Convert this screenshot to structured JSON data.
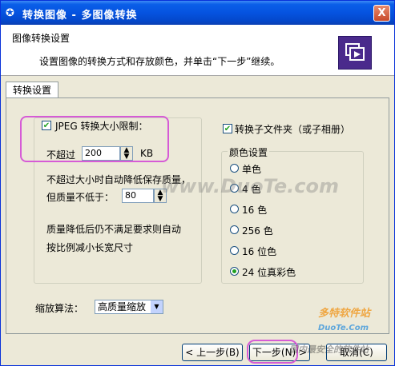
{
  "window": {
    "title": "转换图像 - 多图像转换",
    "close_glyph": "X"
  },
  "header": {
    "title": "图像转换设置",
    "description": "设置图像的转换方式和存放颜色，并单击“下一步”继续。"
  },
  "tab": {
    "label": "转换设置"
  },
  "jpeg": {
    "checkbox_label": "JPEG 转换大小限制：",
    "checked": true,
    "limit_label": "不超过",
    "limit_value": "200",
    "unit": "KB",
    "auto_text_1": "不超过大小时自动降低保存质量，",
    "quality_label": "但质量不低于：",
    "quality_value": "80",
    "note_1": "质量降低后仍不满足要求则自动",
    "note_2": "按比例减小长宽尺寸"
  },
  "subfolder": {
    "checkbox_label": "转换子文件夹（或子相册）",
    "checked": true
  },
  "color": {
    "group_label": "颜色设置",
    "options": [
      "单色",
      "4 色",
      "16 色",
      "256 色",
      "16 位色",
      "24 位真彩色"
    ],
    "selected_index": 5
  },
  "scale": {
    "label": "缩放算法：",
    "value": "高质量缩放"
  },
  "buttons": {
    "back": "< 上一步(B)",
    "next": "下一步(N) >",
    "cancel": "取消(C)"
  },
  "watermarks": {
    "center": "www.DuoTe.com",
    "logo": "多特软件站",
    "logo_url": "DuoTe.Com",
    "bottom": "国内最安全的软件站"
  },
  "colors": {
    "titlebar": "#0553e0",
    "highlight": "#d65bd6",
    "header_icon": "#4a2a8c"
  }
}
